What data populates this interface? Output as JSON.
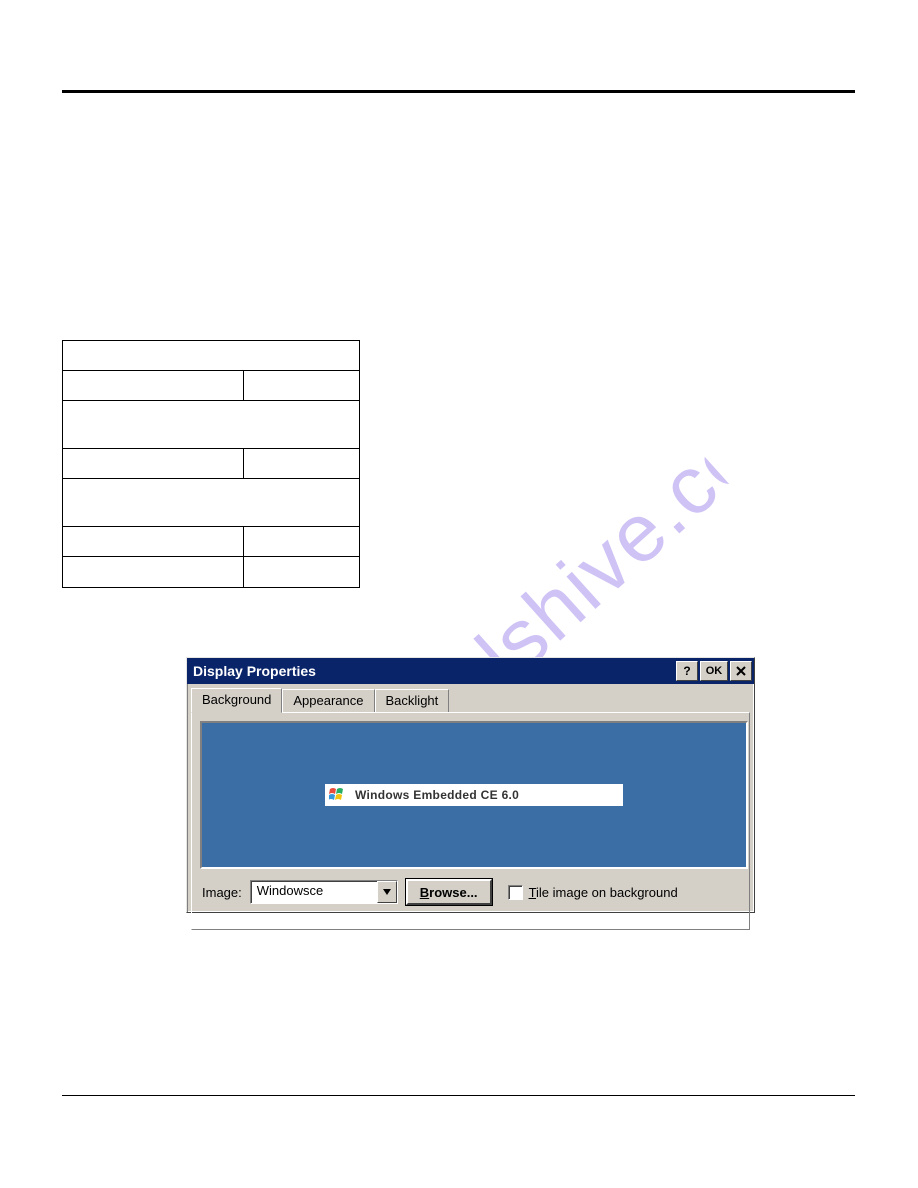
{
  "watermark": "manualshive.com",
  "dialog": {
    "title": "Display Properties",
    "buttons": {
      "help": "?",
      "ok": "OK",
      "close": "×"
    },
    "tabs": {
      "background": "Background",
      "appearance": "Appearance",
      "backlight": "Backlight"
    },
    "preview_banner_text": "Windows Embedded CE 6.0",
    "image_label": "Image:",
    "image_value": "Windowsce",
    "browse_prefix": "B",
    "browse_rest": "rowse...",
    "tile_prefix": "T",
    "tile_rest": "ile image on background"
  }
}
